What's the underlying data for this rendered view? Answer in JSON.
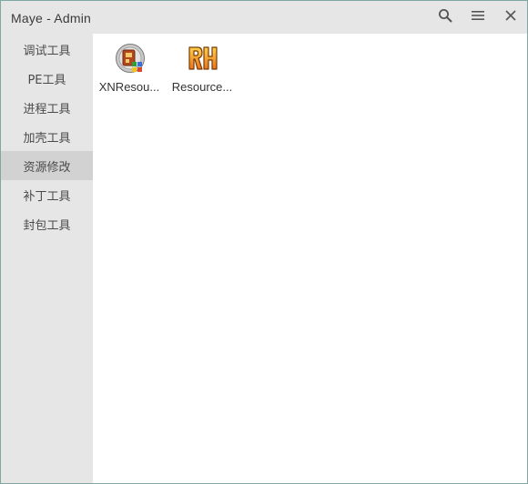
{
  "window": {
    "title": "Maye - Admin"
  },
  "titlebar": {
    "buttons": [
      {
        "icon": "search-icon"
      },
      {
        "icon": "hamburger-menu-icon"
      },
      {
        "icon": "close-icon"
      }
    ]
  },
  "sidebar": {
    "items": [
      {
        "label": "调试工具",
        "active": false
      },
      {
        "label": "PE工具",
        "active": false
      },
      {
        "label": "进程工具",
        "active": false
      },
      {
        "label": "加壳工具",
        "active": false
      },
      {
        "label": "资源修改",
        "active": true
      },
      {
        "label": "补丁工具",
        "active": false
      },
      {
        "label": "封包工具",
        "active": false
      }
    ]
  },
  "content": {
    "apps": [
      {
        "label": "XNResou...",
        "icon": "xnresource-app-icon"
      },
      {
        "label": "Resource...",
        "icon": "resource-hacker-app-icon"
      }
    ]
  },
  "colors": {
    "window_border": "#7fa8a3",
    "chrome_background": "#e6e6e6",
    "active_item": "#d2d2d2",
    "content_background": "#ffffff"
  }
}
